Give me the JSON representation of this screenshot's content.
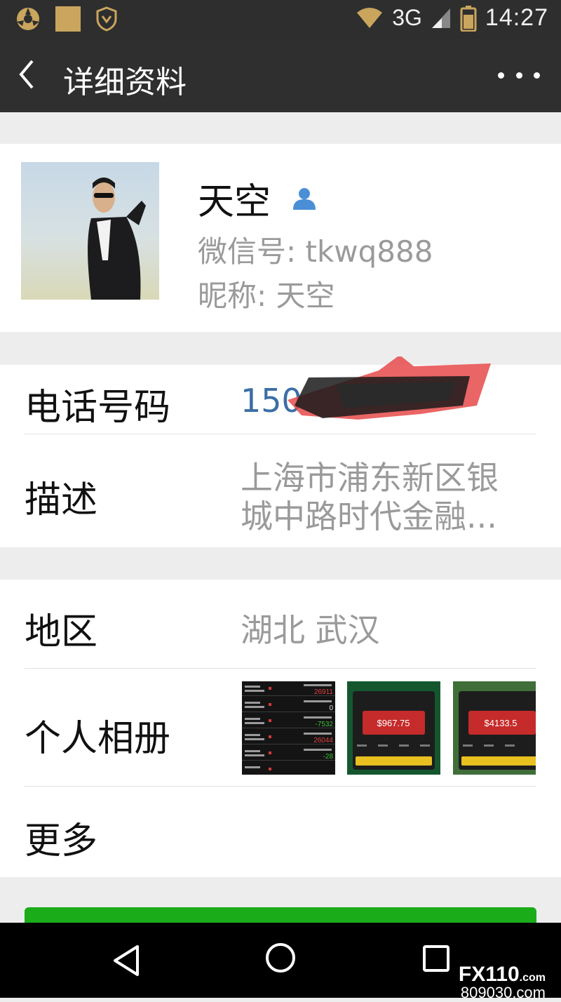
{
  "status_bar": {
    "network": "3G",
    "time": "14:27"
  },
  "header": {
    "title": "详细资料"
  },
  "profile": {
    "name": "天空",
    "wechat_id": "微信号: tkwq888",
    "nickname": "昵称: 天空"
  },
  "phone": {
    "label": "电话号码",
    "value": "150"
  },
  "description": {
    "label": "描述",
    "value_line1": "上海市浦东新区银",
    "value_line2": "城中路时代金融..."
  },
  "region": {
    "label": "地区",
    "value": "湖北  武汉"
  },
  "album": {
    "label": "个人相册",
    "thumbs": [
      {
        "kind": "trade-list",
        "values": [
          "26911",
          "0",
          "-7532",
          "26044",
          "-28"
        ]
      },
      {
        "kind": "card",
        "amount": "$967.75"
      },
      {
        "kind": "card",
        "amount": "$4133.5"
      }
    ]
  },
  "more": {
    "label": "更多"
  },
  "colors": {
    "accent_green": "#1aad19",
    "bar_dark": "#2f2f2f"
  },
  "watermark": {
    "logo": "FX110",
    "logo_suffix": ".com",
    "url": "809030.com"
  }
}
